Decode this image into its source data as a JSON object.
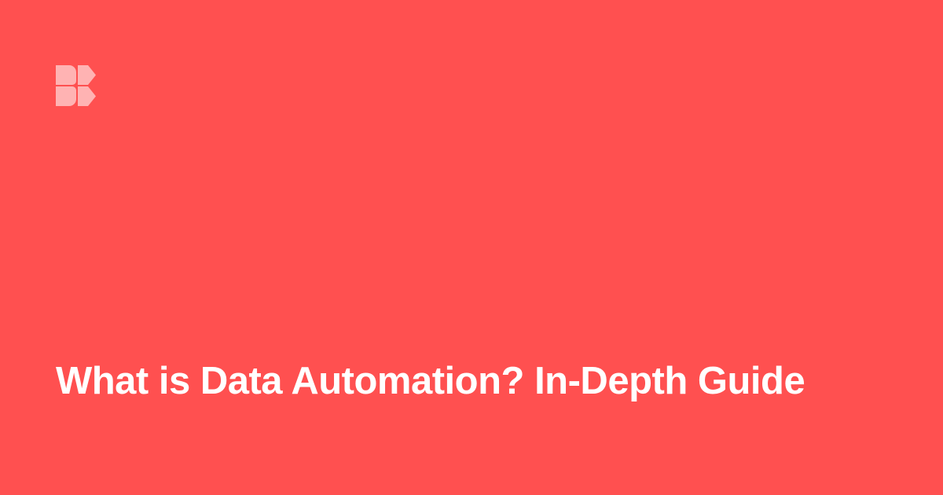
{
  "card": {
    "background_color": "#FF5050",
    "title": "What is Data Automation? In-Depth Guide",
    "title_color": "#FFFFFF",
    "logo": {
      "icon": "brand-logo-icon",
      "color": "#FFB3B3"
    }
  }
}
